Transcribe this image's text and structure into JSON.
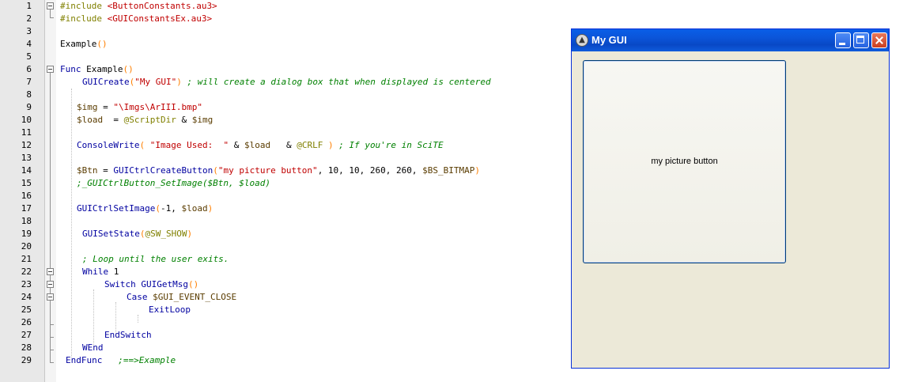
{
  "editor": {
    "lines": [
      {
        "n": "1",
        "html": "#include <ButtonConstants.au3>",
        "indent": 76
      },
      {
        "n": "2",
        "text": "#include <GUIConstantsEx.au3>",
        "indent": 76
      },
      {
        "n": "3",
        "text": "",
        "indent": 76
      },
      {
        "n": "4",
        "text": "Example()",
        "indent": 76
      },
      {
        "n": "5",
        "text": "",
        "indent": 76
      },
      {
        "n": "6",
        "text": "Func Example()",
        "indent": 76
      },
      {
        "n": "7",
        "text": "GUICreate(\"My GUI\") ; will create a dialog box that when displayed is centered",
        "indent": 104
      },
      {
        "n": "8",
        "text": "",
        "indent": 97
      },
      {
        "n": "9",
        "text": "$img = \"\\Imgs\\ArIII.bmp\"",
        "indent": 97
      },
      {
        "n": "10",
        "text": "$load  = @ScriptDir & $img",
        "indent": 97
      },
      {
        "n": "11",
        "text": "",
        "indent": 97
      },
      {
        "n": "12",
        "text": "ConsoleWrite( \"Image Used:  \" & $load   & @CRLF ) ; If you're in SciTE",
        "indent": 97
      },
      {
        "n": "13",
        "text": "",
        "indent": 97
      },
      {
        "n": "14",
        "text": "$Btn = GUICtrlCreateButton(\"my picture button\", 10, 10, 260, 260, $BS_BITMAP)",
        "indent": 97
      },
      {
        "n": "15",
        "text": ";_GUICtrlButton_SetImage($Btn, $load)",
        "indent": 97
      },
      {
        "n": "16",
        "text": "",
        "indent": 97
      },
      {
        "n": "17",
        "text": "GUICtrlSetImage(-1, $load)",
        "indent": 97
      },
      {
        "n": "18",
        "text": "",
        "indent": 97
      },
      {
        "n": "19",
        "text": "GUISetState(@SW_SHOW)",
        "indent": 104
      },
      {
        "n": "20",
        "text": "",
        "indent": 104
      },
      {
        "n": "21",
        "text": "; Loop until the user exits.",
        "indent": 104
      },
      {
        "n": "22",
        "text": "While 1",
        "indent": 104
      },
      {
        "n": "23",
        "text": "Switch GUIGetMsg()",
        "indent": 132
      },
      {
        "n": "24",
        "text": "Case $GUI_EVENT_CLOSE",
        "indent": 160
      },
      {
        "n": "25",
        "text": "ExitLoop",
        "indent": 188
      },
      {
        "n": "26",
        "text": "",
        "indent": 132
      },
      {
        "n": "27",
        "text": "EndSwitch",
        "indent": 132
      },
      {
        "n": "28",
        "text": "WEnd",
        "indent": 104
      },
      {
        "n": "29",
        "text": "EndFunc   ;==>Example",
        "indent": 83
      }
    ]
  },
  "window": {
    "title": "My GUI",
    "button_label": "my picture button"
  }
}
